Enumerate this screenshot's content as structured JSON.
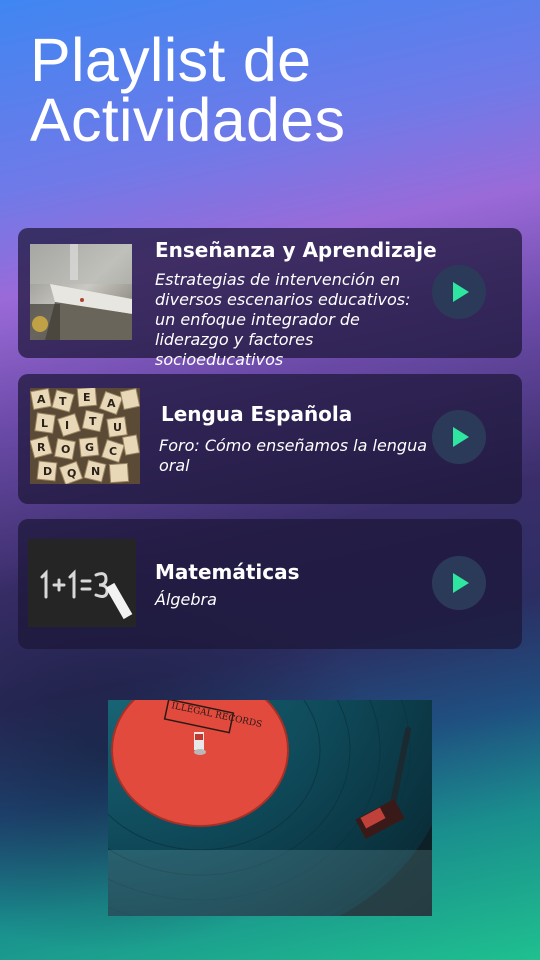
{
  "header": {
    "title": "Playlist de Actividades"
  },
  "activities": [
    {
      "title": "Enseñanza y Aprendizaje",
      "subtitle": "Estrategias de intervención en diversos escenarios educativos: un enfoque integrador de liderazgo y factores socioeducativos",
      "thumbnail_icon": "classroom-photo-icon",
      "play_icon": "play-icon"
    },
    {
      "title": "Lengua Española",
      "subtitle": "Foro: Cómo enseñamos la lengua oral",
      "thumbnail_icon": "letter-tiles-photo-icon",
      "play_icon": "play-icon"
    },
    {
      "title": "Matemáticas",
      "subtitle": "Álgebra",
      "thumbnail_icon": "chalkboard-photo-icon",
      "play_icon": "play-icon"
    }
  ],
  "footer_image": {
    "icon": "vinyl-record-photo-icon",
    "label_text": "ILLEGAL RECORDS"
  },
  "colors": {
    "accent": "#2ee6a0",
    "card_bg": "#1c1638",
    "play_bg": "#2c3a5a"
  }
}
